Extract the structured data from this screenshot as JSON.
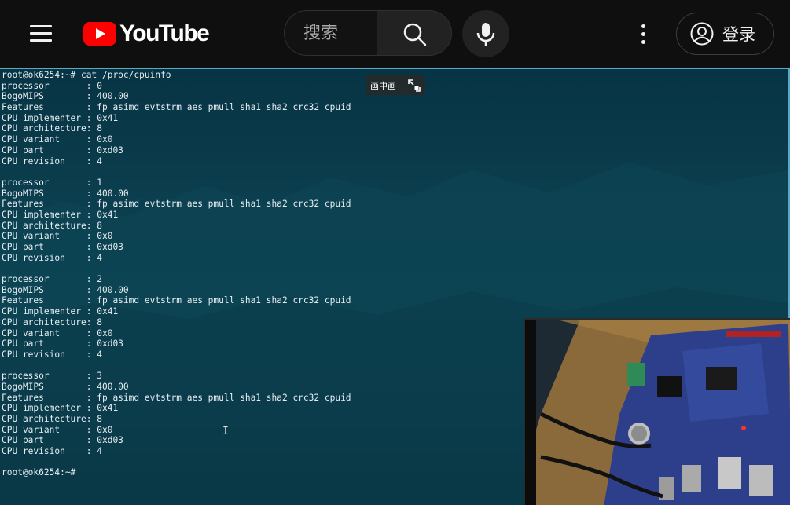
{
  "header": {
    "logo_text": "YouTube",
    "search_placeholder": "搜索",
    "login_label": "登录",
    "brand_color": "#ff0000"
  },
  "icons": {
    "menu": "hamburger-menu-icon",
    "search": "magnifier-icon",
    "mic": "microphone-icon",
    "more": "vertical-dots-icon",
    "account": "user-circle-icon",
    "pip": "picture-in-picture-icon"
  },
  "video": {
    "pip_badge_label": "画中画",
    "cursor_glyph": "I",
    "terminal_lines": [
      "root@ok6254:~# cat /proc/cpuinfo",
      "processor       : 0",
      "BogoMIPS        : 400.00",
      "Features        : fp asimd evtstrm aes pmull sha1 sha2 crc32 cpuid",
      "CPU implementer : 0x41",
      "CPU architecture: 8",
      "CPU variant     : 0x0",
      "CPU part        : 0xd03",
      "CPU revision    : 4",
      "",
      "processor       : 1",
      "BogoMIPS        : 400.00",
      "Features        : fp asimd evtstrm aes pmull sha1 sha2 crc32 cpuid",
      "CPU implementer : 0x41",
      "CPU architecture: 8",
      "CPU variant     : 0x0",
      "CPU part        : 0xd03",
      "CPU revision    : 4",
      "",
      "processor       : 2",
      "BogoMIPS        : 400.00",
      "Features        : fp asimd evtstrm aes pmull sha1 sha2 crc32 cpuid",
      "CPU implementer : 0x41",
      "CPU architecture: 8",
      "CPU variant     : 0x0",
      "CPU part        : 0xd03",
      "CPU revision    : 4",
      "",
      "processor       : 3",
      "BogoMIPS        : 400.00",
      "Features        : fp asimd evtstrm aes pmull sha1 sha2 crc32 cpuid",
      "CPU implementer : 0x41",
      "CPU architecture: 8",
      "CPU variant     : 0x0",
      "CPU part        : 0xd03",
      "CPU revision    : 4",
      "",
      "root@ok6254:~#"
    ]
  }
}
